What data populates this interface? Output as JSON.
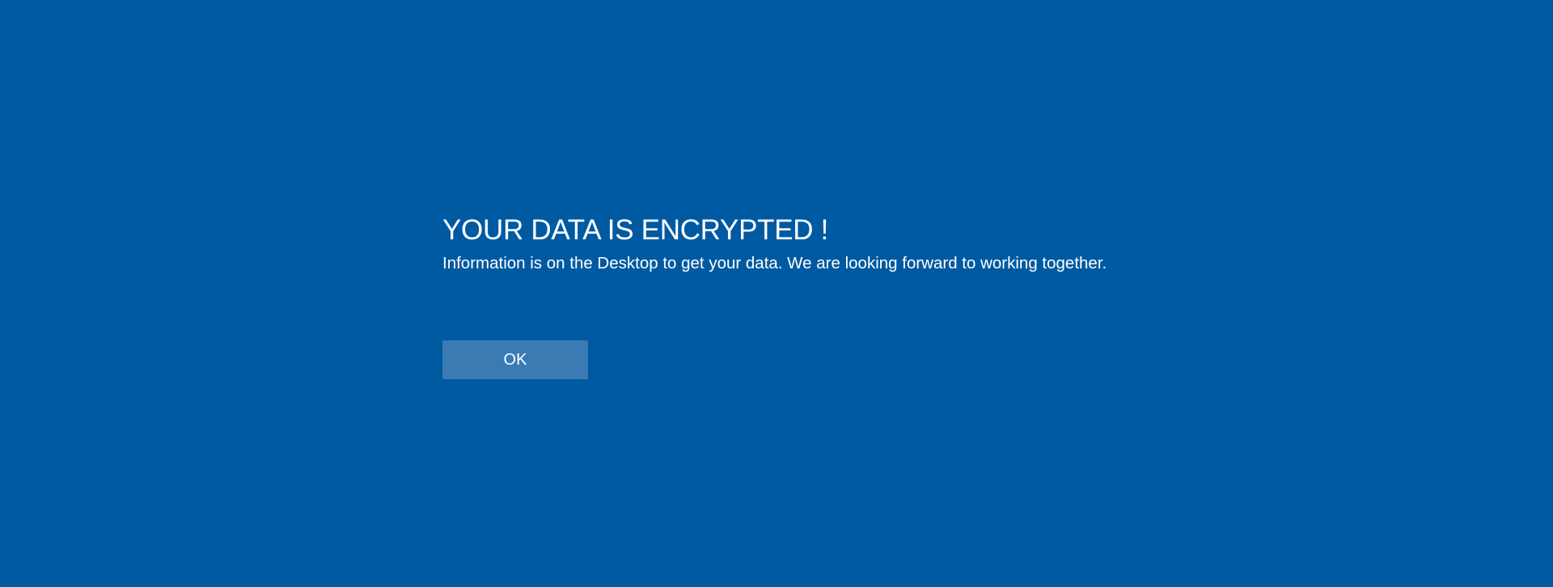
{
  "dialog": {
    "title": "YOUR DATA IS ENCRYPTED !",
    "message": "Information is on the Desktop to get your data.  We are looking forward to working together.",
    "ok_label": "OK"
  },
  "colors": {
    "background": "#005aa1",
    "button": "#3a7bb4",
    "text": "#ffffff"
  }
}
